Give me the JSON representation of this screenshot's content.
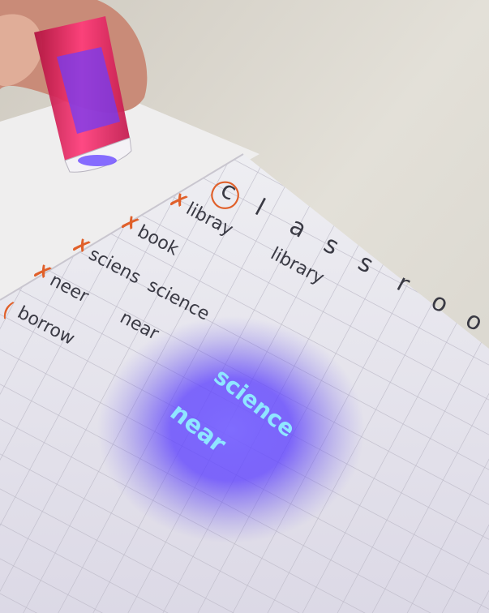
{
  "photo": {
    "description_kind": "photo",
    "handwriting": {
      "letters": [
        "c",
        "l",
        "a",
        "s",
        "s",
        "r",
        "o",
        "o"
      ],
      "rows": [
        {
          "mark": "✗",
          "written": "libray",
          "correction": "library"
        },
        {
          "mark": "✗",
          "written": "book",
          "correction": ""
        },
        {
          "mark": "✗",
          "written": "sciens",
          "correction": "science"
        },
        {
          "mark": "✗",
          "written": "neer",
          "correction": "near"
        },
        {
          "mark": "",
          "written": "borrow",
          "correction": ""
        }
      ]
    },
    "invisible_ink": {
      "lines": [
        "science",
        "near"
      ]
    },
    "colors": {
      "wall": "#d9d5cd",
      "paper": "#e9e6ee",
      "grid": "#b9b6c4",
      "ink": "#3a3a44",
      "red_ink": "#e0602a",
      "uv_glow": "#5a3cff",
      "uv_text": "#8fe6ff",
      "pen_body": "#e0205a"
    }
  }
}
